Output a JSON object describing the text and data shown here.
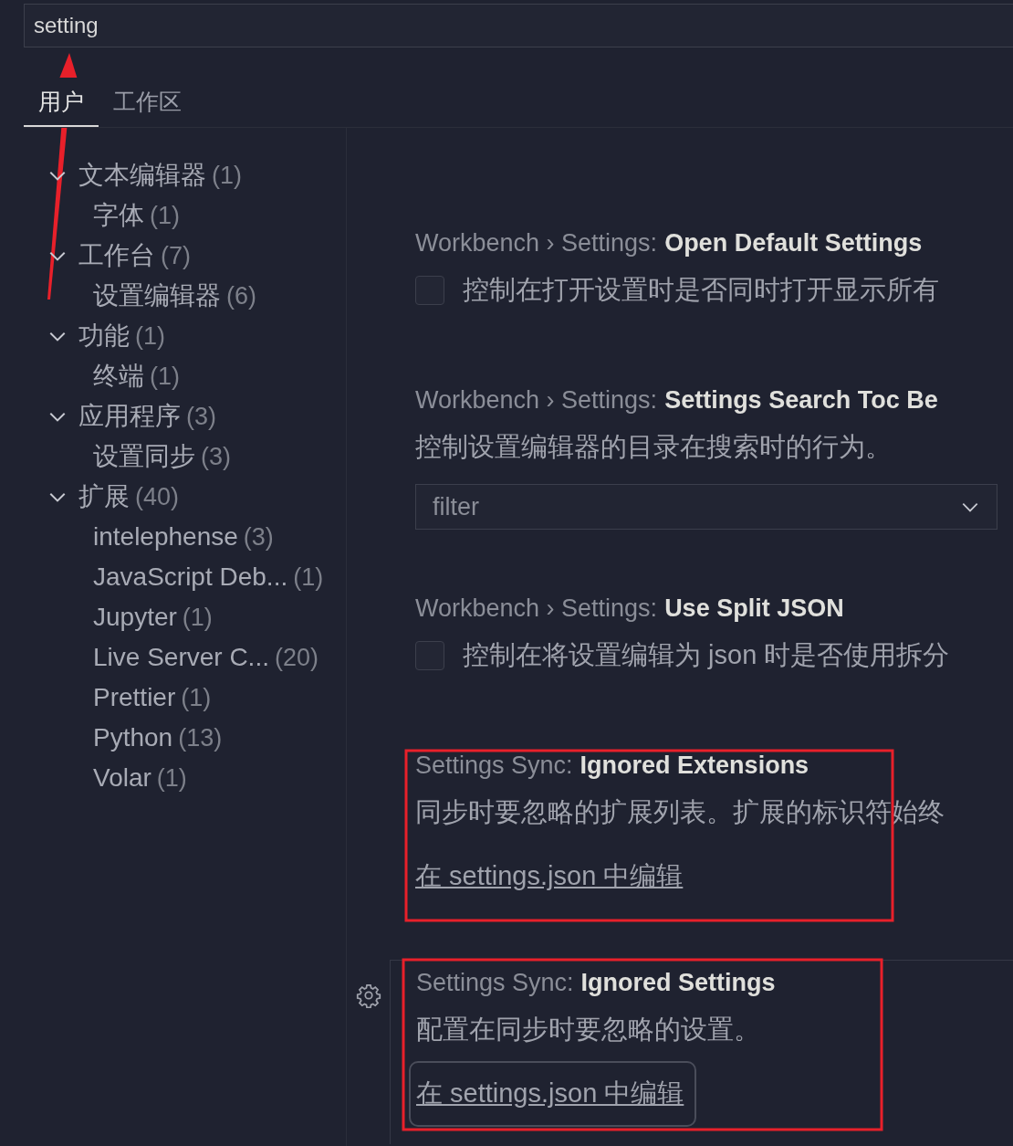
{
  "search": {
    "value": "setting"
  },
  "tabs": [
    {
      "label": "用户",
      "selected": true
    },
    {
      "label": "工作区",
      "selected": false
    }
  ],
  "toc": [
    {
      "label": "文本编辑器",
      "count": "(1)",
      "expanded": true,
      "children": [
        {
          "label": "字体",
          "count": "(1)"
        }
      ]
    },
    {
      "label": "工作台",
      "count": "(7)",
      "expanded": true,
      "children": [
        {
          "label": "设置编辑器",
          "count": "(6)"
        }
      ]
    },
    {
      "label": "功能",
      "count": "(1)",
      "expanded": true,
      "children": [
        {
          "label": "终端",
          "count": "(1)"
        }
      ]
    },
    {
      "label": "应用程序",
      "count": "(3)",
      "expanded": true,
      "children": [
        {
          "label": "设置同步",
          "count": "(3)"
        }
      ]
    },
    {
      "label": "扩展",
      "count": "(40)",
      "expanded": true,
      "children": [
        {
          "label": "intelephense",
          "count": "(3)"
        },
        {
          "label": "JavaScript Deb...",
          "count": "(1)"
        },
        {
          "label": "Jupyter",
          "count": "(1)"
        },
        {
          "label": "Live Server C...",
          "count": "(20)"
        },
        {
          "label": "Prettier",
          "count": "(1)"
        },
        {
          "label": "Python",
          "count": "(13)"
        },
        {
          "label": "Volar",
          "count": "(1)"
        }
      ]
    }
  ],
  "settings": [
    {
      "kind": "checkbox",
      "category": "Workbench › Settings:",
      "name": "Open Default Settings",
      "description": "控制在打开设置时是否同时打开显示所有",
      "checked": false,
      "focused": false
    },
    {
      "kind": "select",
      "category": "Workbench › Settings:",
      "name": "Settings Search Toc Be",
      "description": "控制设置编辑器的目录在搜索时的行为。",
      "value": "filter",
      "focused": false
    },
    {
      "kind": "checkbox",
      "category": "Workbench › Settings:",
      "name": "Use Split JSON",
      "description": "控制在将设置编辑为 json 时是否使用拆分",
      "checked": false,
      "focused": false
    },
    {
      "kind": "link",
      "category": "Settings Sync:",
      "name": "Ignored Extensions",
      "description": "同步时要忽略的扩展列表。扩展的标识符始终",
      "link": "在 settings.json 中编辑",
      "focused": false
    },
    {
      "kind": "link",
      "category": "Settings Sync:",
      "name": "Ignored Settings",
      "description": "配置在同步时要忽略的设置。",
      "link": "在 settings.json 中编辑",
      "focused": true
    }
  ]
}
